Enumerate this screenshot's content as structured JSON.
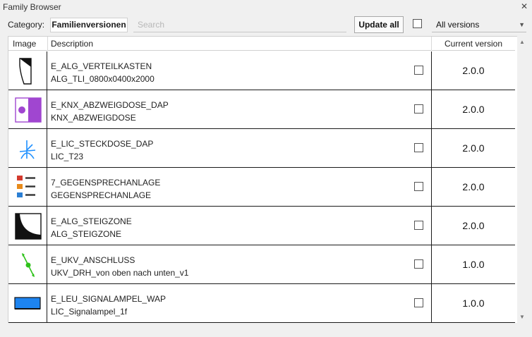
{
  "window": {
    "title": "Family Browser",
    "close_glyph": "✕"
  },
  "toolbar": {
    "category_label": "Category:",
    "category_value": "Familienversionen",
    "search_placeholder": "Search",
    "search_value": "",
    "update_label": "Update all",
    "select_all_checked": false,
    "versions_value": "All versions",
    "versions_arrow": "▼"
  },
  "table": {
    "headers": {
      "image": "Image",
      "description": "Description",
      "current_version": "Current version"
    },
    "rows": [
      {
        "icon": "distribution-box-icon",
        "name": "E_ALG_VERTEILKASTEN",
        "type": "ALG_TLI_0800x0400x2000",
        "checked": false,
        "version": "2.0.0"
      },
      {
        "icon": "junction-box-icon",
        "name": "E_KNX_ABZWEIGDOSE_DAP",
        "type": "KNX_ABZWEIGDOSE",
        "checked": false,
        "version": "2.0.0"
      },
      {
        "icon": "socket-outlet-icon",
        "name": "E_LIC_STECKDOSE_DAP",
        "type": "LIC_T23",
        "checked": false,
        "version": "2.0.0"
      },
      {
        "icon": "intercom-icon",
        "name": "7_GEGENSPRECHANLAGE",
        "type": "GEGENSPRECHANLAGE",
        "checked": false,
        "version": "2.0.0"
      },
      {
        "icon": "riser-zone-icon",
        "name": "E_ALG_STEIGZONE",
        "type": "ALG_STEIGZONE",
        "checked": false,
        "version": "2.0.0"
      },
      {
        "icon": "connection-icon",
        "name": "E_UKV_ANSCHLUSS",
        "type": "UKV_DRH_von oben nach unten_v1",
        "checked": false,
        "version": "1.0.0"
      },
      {
        "icon": "signal-lamp-icon",
        "name": "E_LEU_SIGNALAMPEL_WAP",
        "type": "LIC_Signalampel_1f",
        "checked": false,
        "version": "1.0.0"
      }
    ]
  },
  "scrollbar": {
    "up_glyph": "▲",
    "down_glyph": "▼"
  },
  "colors": {
    "junction_purple": "#a046d0",
    "socket_blue": "#1e90ff",
    "connection_green": "#2ec21a",
    "signal_blue": "#1d84f0",
    "intercom_red": "#d33a2e",
    "intercom_orange": "#e88a1a",
    "intercom_blue": "#2b7fd4"
  }
}
